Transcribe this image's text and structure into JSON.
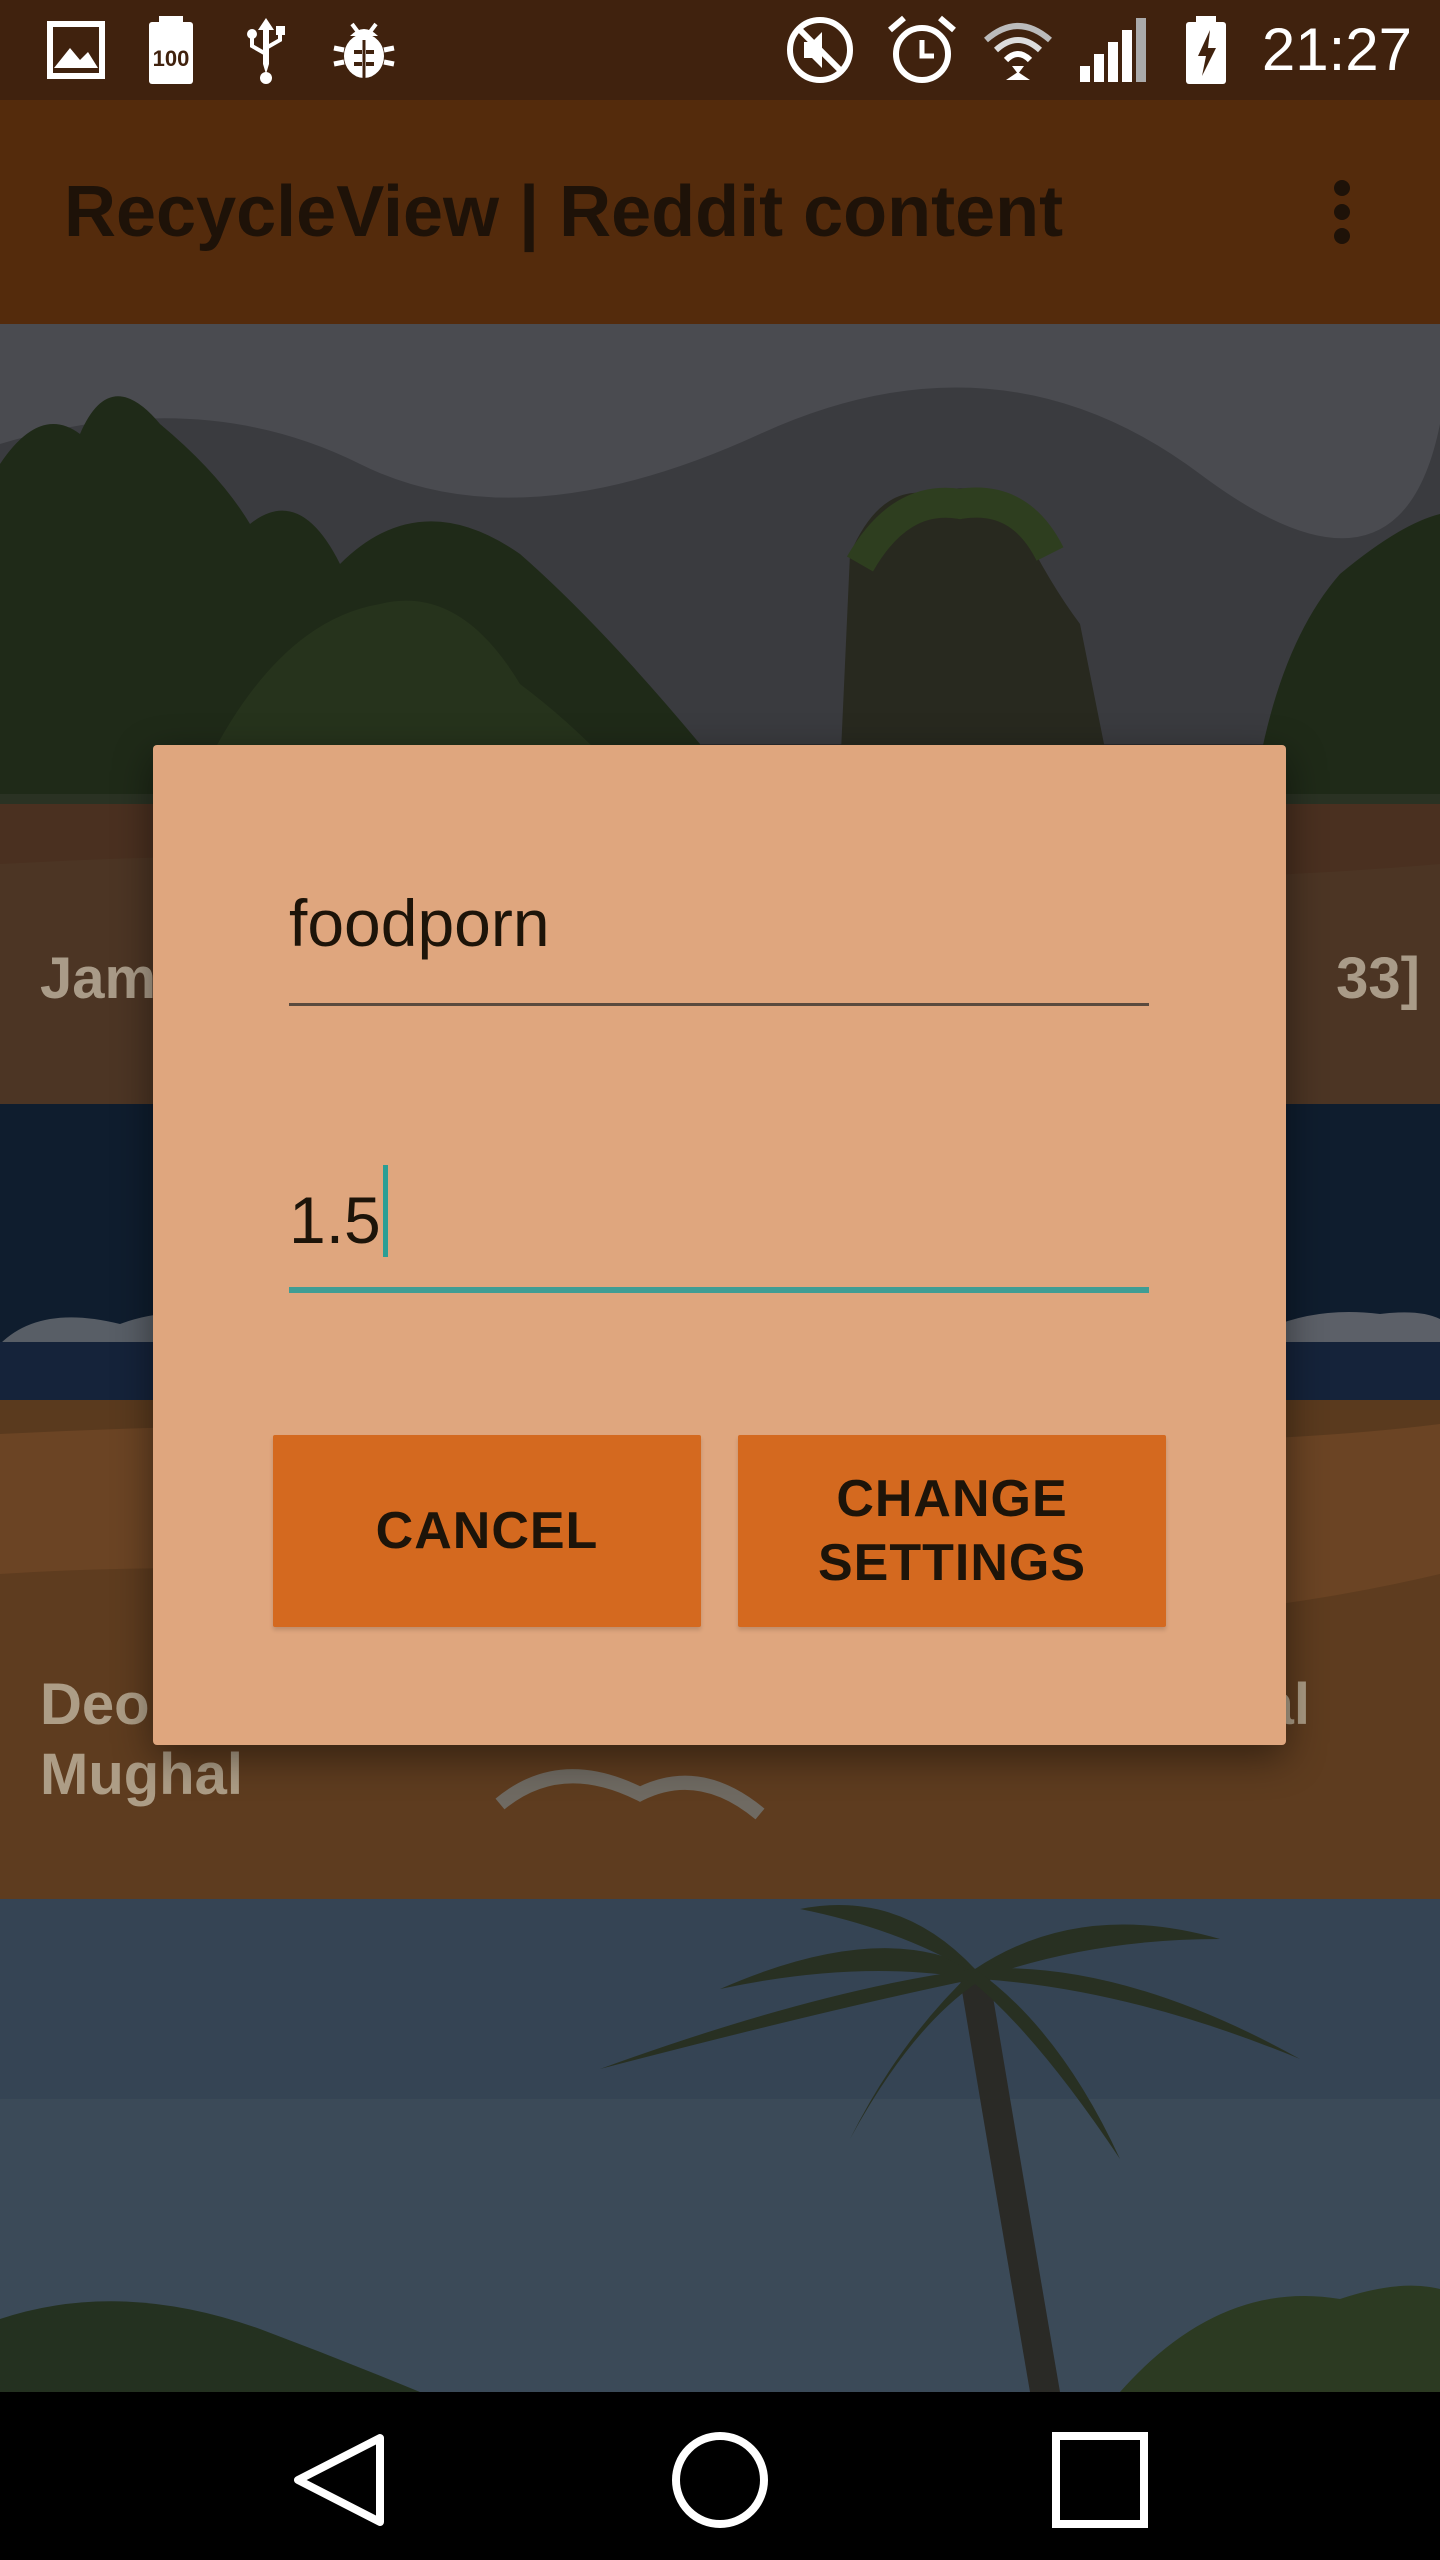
{
  "status_bar": {
    "time": "21:27",
    "left_icons": [
      "image-icon",
      "battery-100-icon",
      "usb-icon",
      "debug-bug-icon"
    ],
    "right_icons": [
      "mute-icon",
      "alarm-icon",
      "wifi-icon",
      "cell-signal-icon",
      "battery-charging-icon"
    ]
  },
  "app_bar": {
    "title": "RecycleView | Reddit content",
    "overflow_icon": "more-vert-icon"
  },
  "feed": {
    "cards": [
      {
        "title_left": "Jam",
        "title_right": "33]"
      },
      {
        "title_left": "Deo",
        "title_right": "al",
        "title_line2": "Mughal"
      },
      {
        "title_left": ""
      }
    ]
  },
  "dialog": {
    "subreddit_value": "foodporn",
    "ratio_value": "1.5",
    "cancel_label": "CANCEL",
    "change_label_line1": "CHANGE",
    "change_label_line2": "SETTINGS"
  },
  "nav_bar": {
    "icons": [
      "back-icon",
      "home-icon",
      "recents-icon"
    ]
  },
  "colors": {
    "status_bar": "#40220e",
    "app_bar": "#542b0c",
    "dialog_bg": "#dfa67e",
    "button_bg": "#d4691f",
    "accent": "#3f9d94"
  }
}
